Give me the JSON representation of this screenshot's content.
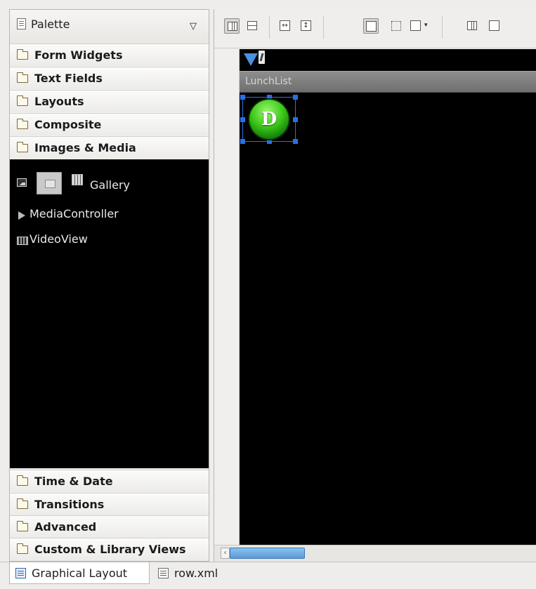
{
  "palette": {
    "title": "Palette",
    "menu_caret": "▽",
    "categories_top": [
      {
        "label": "Form Widgets",
        "open": false
      },
      {
        "label": "Text Fields",
        "open": false
      },
      {
        "label": "Layouts",
        "open": false
      },
      {
        "label": "Composite",
        "open": false
      },
      {
        "label": "Images & Media",
        "open": true
      }
    ],
    "media_items": {
      "gallery": "Gallery",
      "media_controller": "MediaController",
      "video_view": "VideoView"
    },
    "categories_bottom": [
      {
        "label": "Time & Date",
        "open": false
      },
      {
        "label": "Transitions",
        "open": false
      },
      {
        "label": "Advanced",
        "open": false
      },
      {
        "label": "Custom & Library Views",
        "open": false
      }
    ]
  },
  "toolbar": {
    "buttons": [
      "layout-horizontal-icon",
      "layout-vertical-icon",
      "fill-width-icon",
      "fill-height-icon",
      "show-margins-icon",
      "select-bounds-icon",
      "zoom-to-fit-icon",
      "emulate-real-size-icon",
      "screenshot-icon"
    ],
    "glyph_fill_width": "↔",
    "glyph_fill_height": "↕",
    "glyph_dropdown": "▾"
  },
  "device": {
    "app_title": "LunchList",
    "row_icon_letter": "D",
    "colors": {
      "selection": "#2a6ee8",
      "icon_green": "#3cc819",
      "signal_blue": "#4b8fe0"
    }
  },
  "scroll": {
    "left_arrow": "‹"
  },
  "tabs": [
    {
      "label": "Graphical Layout",
      "active": true
    },
    {
      "label": "row.xml",
      "active": false
    }
  ]
}
